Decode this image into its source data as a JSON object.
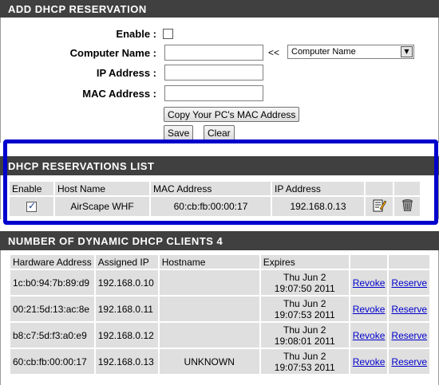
{
  "add_reservation": {
    "title": "ADD DHCP RESERVATION",
    "enable_label": "Enable :",
    "computer_name_label": "Computer Name :",
    "ip_address_label": "IP Address :",
    "mac_address_label": "MAC Address :",
    "computer_name_value": "",
    "ip_address_value": "",
    "mac_address_value": "",
    "copy_arrows": "<<",
    "computer_name_select": "Computer Name",
    "copy_mac_button": "Copy Your PC's MAC Address",
    "save_button": "Save",
    "clear_button": "Clear"
  },
  "reservations_list": {
    "title": "DHCP RESERVATIONS LIST",
    "headers": [
      "Enable",
      "Host Name",
      "MAC Address",
      "IP Address"
    ],
    "rows": [
      {
        "enabled": true,
        "host_name": "AirScape WHF",
        "mac": "60:cb:fb:00:00:17",
        "ip": "192.168.0.13"
      }
    ]
  },
  "dynamic_clients": {
    "title": "NUMBER OF DYNAMIC DHCP CLIENTS 4",
    "headers": [
      "Hardware Address",
      "Assigned IP",
      "Hostname",
      "Expires"
    ],
    "revoke_label": "Revoke",
    "reserve_label": "Reserve",
    "rows": [
      {
        "hw": "1c:b0:94:7b:89:d9",
        "ip": "192.168.0.10",
        "hostname": "",
        "expires_date": "Thu Jun 2",
        "expires_time": "19:07:50 2011"
      },
      {
        "hw": "00:21:5d:13:ac:8e",
        "ip": "192.168.0.11",
        "hostname": "",
        "expires_date": "Thu Jun 2",
        "expires_time": "19:07:53 2011"
      },
      {
        "hw": "b8:c7:5d:f3:a0:e9",
        "ip": "192.168.0.12",
        "hostname": "",
        "expires_date": "Thu Jun 2",
        "expires_time": "19:08:01 2011"
      },
      {
        "hw": "60:cb:fb:00:00:17",
        "ip": "192.168.0.13",
        "hostname": "UNKNOWN",
        "expires_date": "Thu Jun 2",
        "expires_time": "19:07:53 2011"
      }
    ]
  },
  "colors": {
    "header_bg": "#404040",
    "cell_bg": "#dfdfdf",
    "highlight": "#0000cc",
    "link": "#0000cc"
  }
}
